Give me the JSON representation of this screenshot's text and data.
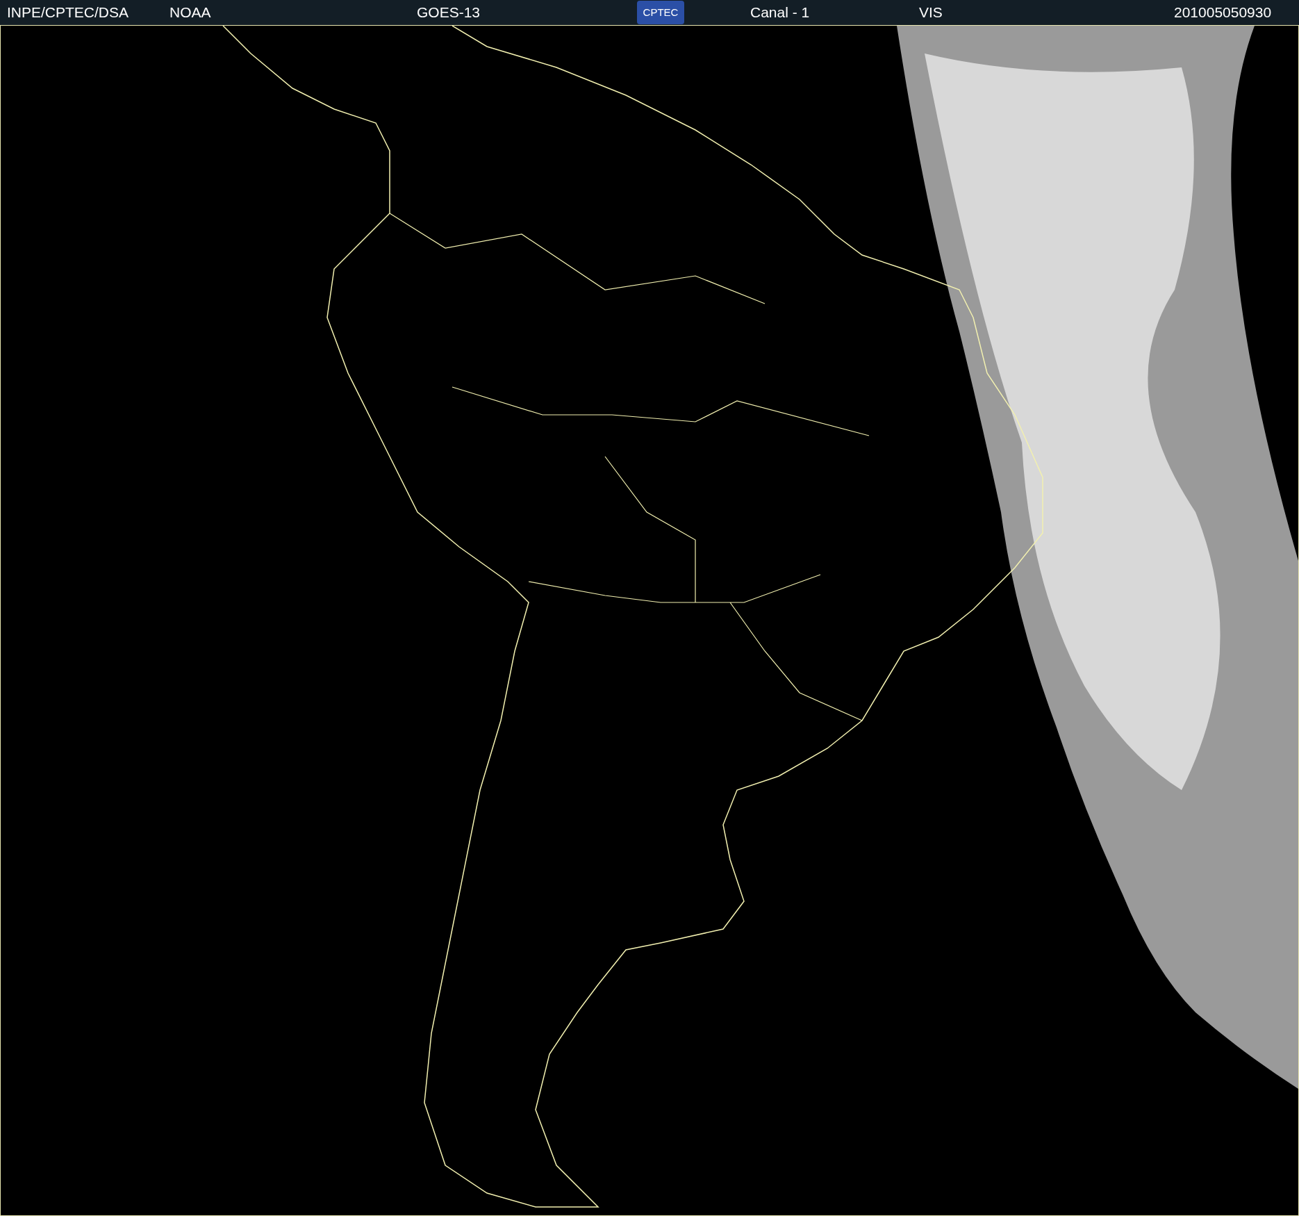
{
  "header": {
    "items": [
      {
        "kind": "text",
        "text": "INPE/CPTEC/DSA"
      },
      {
        "kind": "text",
        "text": "NOAA"
      },
      {
        "kind": "text",
        "text": "GOES-13"
      },
      {
        "kind": "logo",
        "text": "CPTEC"
      },
      {
        "kind": "text",
        "text": "Canal - 1"
      },
      {
        "kind": "text",
        "text": "VIS"
      },
      {
        "kind": "text",
        "text": "201005050930"
      }
    ]
  }
}
